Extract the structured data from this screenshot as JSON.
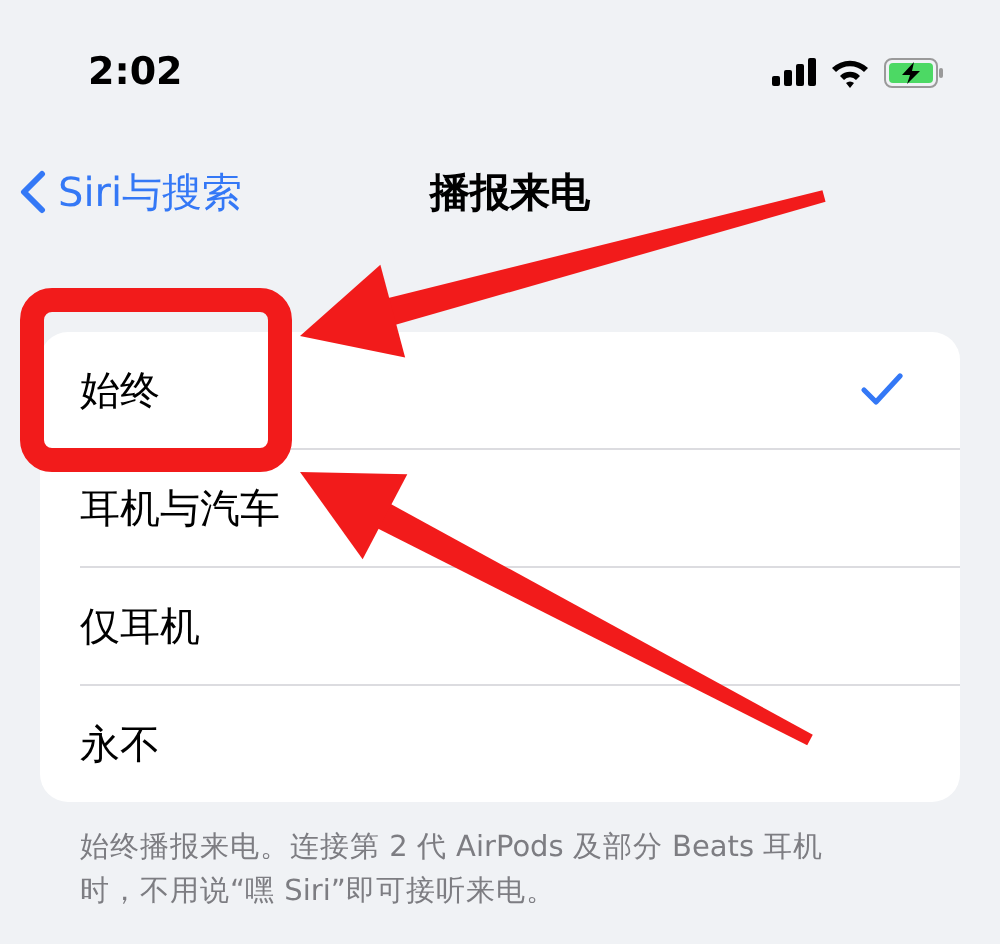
{
  "status_bar": {
    "time": "2:02"
  },
  "nav": {
    "back": "Siri与搜索",
    "title": "播报来电"
  },
  "options": [
    {
      "label": "始终",
      "selected": true
    },
    {
      "label": "耳机与汽车",
      "selected": false
    },
    {
      "label": "仅耳机",
      "selected": false
    },
    {
      "label": "永不",
      "selected": false
    }
  ],
  "footer": "始终播报来电。连接第 2 代 AirPods 及部分 Beats 耳机时，不用说“嘿 Siri”即可接听来电。",
  "annotations": [
    {
      "kind": "box"
    },
    {
      "kind": "arrow"
    },
    {
      "kind": "arrow"
    }
  ]
}
